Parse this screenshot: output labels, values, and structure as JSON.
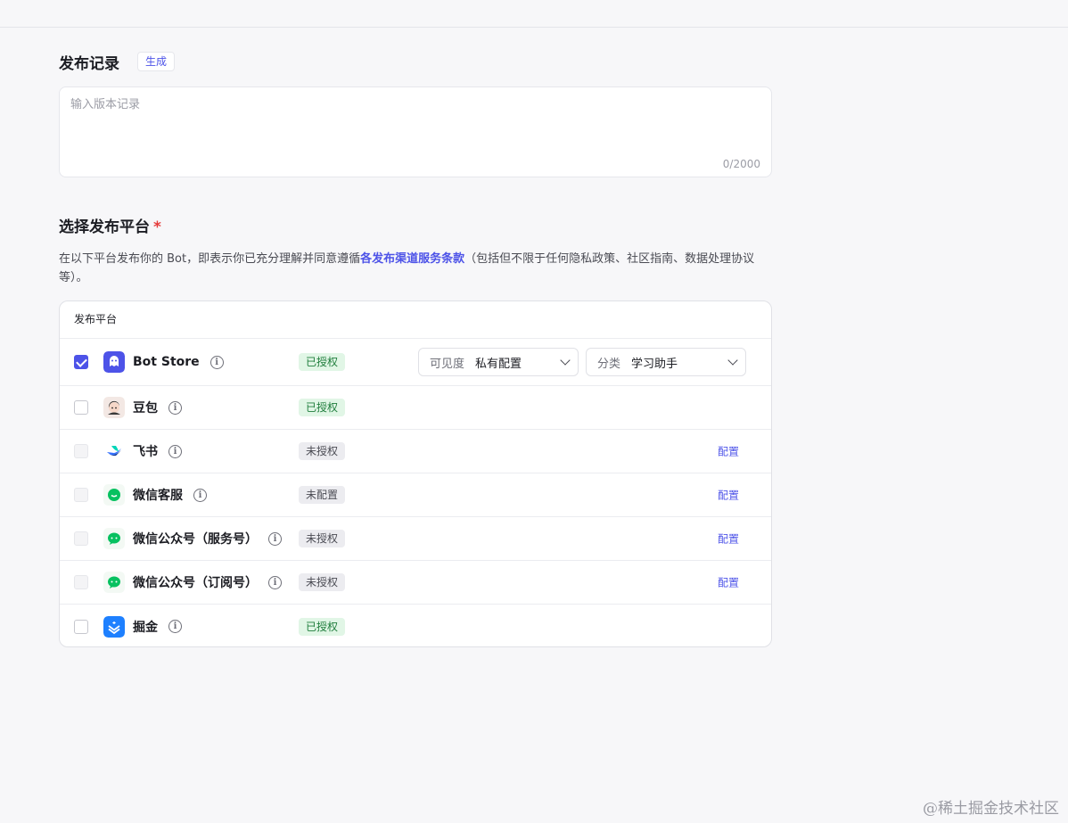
{
  "release_notes": {
    "title": "发布记录",
    "generate_label": "生成",
    "placeholder": "输入版本记录",
    "counter": "0/2000"
  },
  "platform_select": {
    "title": "选择发布平台",
    "required_mark": "*",
    "desc_before": "在以下平台发布你的 Bot，即表示你已充分理解并同意遵循",
    "desc_link": "各发布渠道服务条款",
    "desc_after": "（包括但不限于任何隐私政策、社区指南、数据处理协议等）。"
  },
  "table": {
    "header": "发布平台",
    "rows": [
      {
        "name": "Bot Store",
        "status": "已授权",
        "status_type": "ok",
        "checked": true,
        "disabled": false,
        "icon": "bot-store-icon"
      },
      {
        "name": "豆包",
        "status": "已授权",
        "status_type": "ok",
        "checked": false,
        "disabled": false,
        "icon": "doubao-icon"
      },
      {
        "name": "飞书",
        "status": "未授权",
        "status_type": "no",
        "checked": false,
        "disabled": true,
        "icon": "feishu-icon",
        "action": "配置"
      },
      {
        "name": "微信客服",
        "status": "未配置",
        "status_type": "no",
        "checked": false,
        "disabled": true,
        "icon": "wechat-service-icon",
        "action": "配置"
      },
      {
        "name": "微信公众号（服务号）",
        "status": "未授权",
        "status_type": "no",
        "checked": false,
        "disabled": true,
        "icon": "wechat-icon",
        "action": "配置"
      },
      {
        "name": "微信公众号（订阅号）",
        "status": "未授权",
        "status_type": "no",
        "checked": false,
        "disabled": true,
        "icon": "wechat-icon",
        "action": "配置"
      },
      {
        "name": "掘金",
        "status": "已授权",
        "status_type": "ok",
        "checked": false,
        "disabled": false,
        "icon": "juejin-icon"
      }
    ],
    "visibility": {
      "label": "可见度",
      "value": "私有配置"
    },
    "category": {
      "label": "分类",
      "value": "学习助手"
    }
  },
  "watermark": "@稀土掘金技术社区",
  "colors": {
    "accent": "#4d53e8",
    "ok_bg": "#e1f6e6",
    "ok_text": "#1f7d3c",
    "required": "#e53b3b"
  }
}
